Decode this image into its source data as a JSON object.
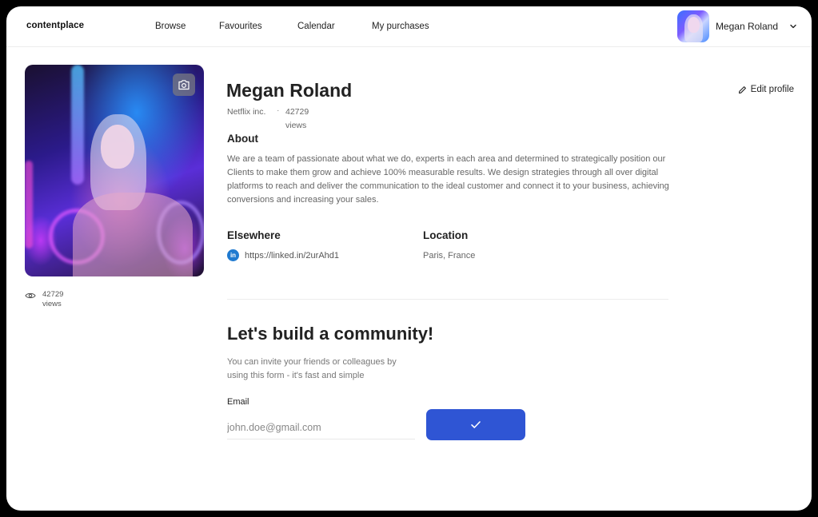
{
  "nav": {
    "logo": "contentplace",
    "links": [
      "Browse",
      "Favourites",
      "Calendar",
      "My purchases"
    ],
    "user_name": "Megan Roland"
  },
  "profile": {
    "name": "Megan Roland",
    "edit_label": "Edit profile",
    "company": "Netflix inc.",
    "separator": "·",
    "views": "42729 views",
    "views_count": "42729",
    "views_unit": "views"
  },
  "about": {
    "heading": "About",
    "text": "We are a team of passionate about what we do, experts in each area and determined to strategically position our Clients to make them grow and achieve 100% measurable results. We design strategies through all over digital platforms to reach and deliver the communication to the ideal customer and connect it to your business, achieving conversions and increasing your sales."
  },
  "elsewhere": {
    "heading": "Elsewhere",
    "icon_text": "in",
    "link": "https://linked.in/2urAhd1"
  },
  "location": {
    "heading": "Location",
    "value": "Paris, France"
  },
  "community": {
    "heading": "Let's build a community!",
    "text": "You can invite your friends or colleagues by using this form - it's fast and simple",
    "email_label": "Email",
    "email_placeholder": "john.doe@gmail.com"
  },
  "colors": {
    "accent": "#2f55d4",
    "linkedin": "#1f7ad0"
  },
  "icons": [
    "camera-icon",
    "eye-icon",
    "pencil-icon",
    "chevron-down-icon",
    "check-icon",
    "linkedin-icon"
  ]
}
